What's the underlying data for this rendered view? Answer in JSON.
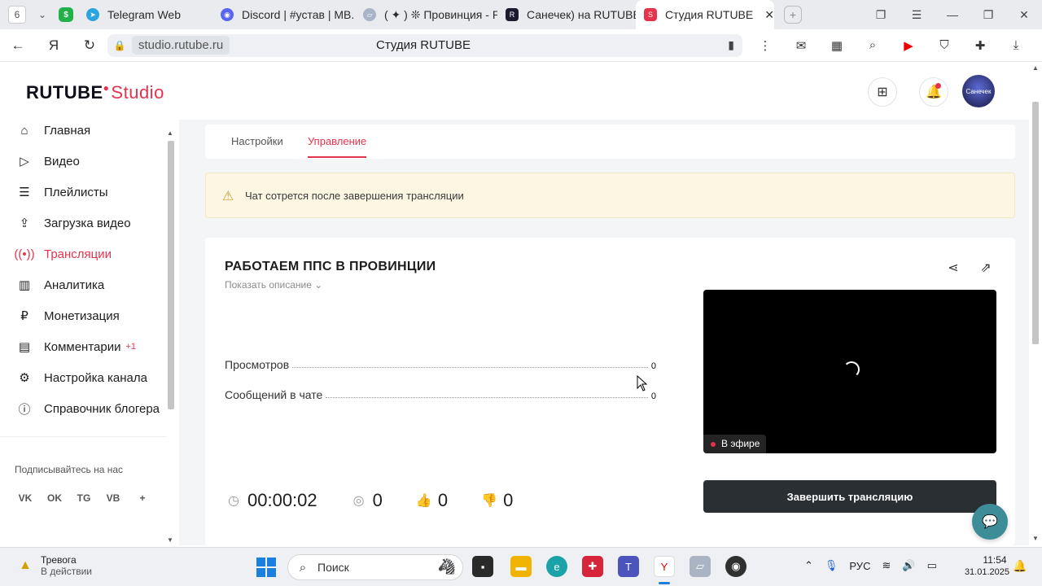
{
  "browser": {
    "tab_count": "6",
    "tabs": [
      {
        "label": "Telegram Web"
      },
      {
        "label": "Discord | #устав | МВ..."
      },
      {
        "label": "( ✦ ) ❊ Провинция - Р"
      },
      {
        "label": "Санечек) на RUTUBE"
      },
      {
        "label": "Студия RUTUBE"
      }
    ],
    "url": "studio.rutube.ru",
    "page_title": "Студия RUTUBE"
  },
  "header": {
    "logo_main": "RUTUBE",
    "logo_studio": "Studio",
    "avatar_text": "Санечек"
  },
  "sidebar": {
    "items": [
      {
        "label": "Главная",
        "icon": "home-icon"
      },
      {
        "label": "Видео",
        "icon": "video-icon"
      },
      {
        "label": "Плейлисты",
        "icon": "playlist-icon"
      },
      {
        "label": "Загрузка видео",
        "icon": "upload-icon"
      },
      {
        "label": "Трансляции",
        "icon": "broadcast-icon",
        "active": true
      },
      {
        "label": "Аналитика",
        "icon": "analytics-icon"
      },
      {
        "label": "Монетизация",
        "icon": "ruble-icon"
      },
      {
        "label": "Комментарии",
        "icon": "comment-icon",
        "badge": "+1"
      },
      {
        "label": "Настройка канала",
        "icon": "gear-icon"
      },
      {
        "label": "Справочник блогера",
        "icon": "info-icon"
      }
    ],
    "subscribe_label": "Подписывайтесь на нас",
    "socials": [
      "VK",
      "OK",
      "TG",
      "VB",
      "+"
    ]
  },
  "main": {
    "tabs": [
      {
        "label": "Настройки"
      },
      {
        "label": "Управление",
        "active": true
      }
    ],
    "warning_text": "Чат сотрется после завершения трансляции",
    "stream_title": "РАБОТАЕМ ППС В ПРОВИНЦИИ",
    "show_description": "Показать описание",
    "stats": [
      {
        "label": "Просмотров",
        "value": "0"
      },
      {
        "label": "Сообщений в чате",
        "value": "0"
      }
    ],
    "live_label": "В эфире",
    "counters": {
      "duration": "00:00:02",
      "viewers": "0",
      "likes": "0",
      "dislikes": "0"
    },
    "end_button": "Завершить трансляцию"
  },
  "taskbar": {
    "alert_title": "Тревога",
    "alert_sub": "В действии",
    "search_placeholder": "Поиск",
    "lang": "РУС",
    "time": "11:54",
    "date": "31.01.2025"
  },
  "colors": {
    "accent": "#e6334d",
    "warning_bg": "#fdf6e3",
    "end_button": "#2a2f33",
    "support": "#3d8d98"
  }
}
